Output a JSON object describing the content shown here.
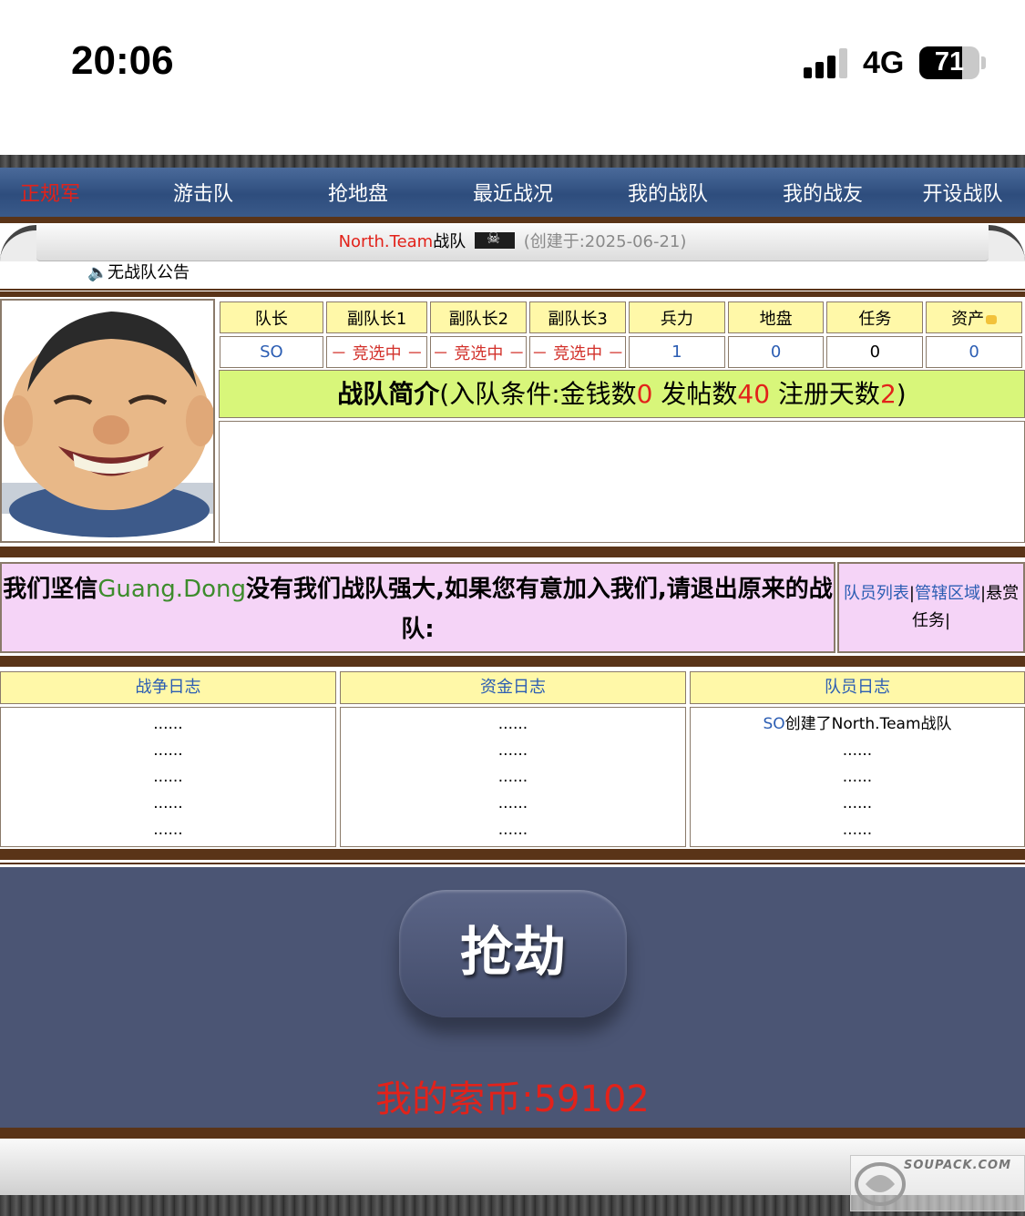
{
  "status_bar": {
    "time": "20:06",
    "network": "4G",
    "battery": "71",
    "battery_level": 0.71
  },
  "nav": {
    "items": [
      "正规军",
      "游击队",
      "抢地盘",
      "最近战况",
      "我的战队",
      "我的战友",
      "开设战队"
    ],
    "active_color": "#e2221a"
  },
  "banner": {
    "team_name": "North.Team",
    "team_suffix": "战队",
    "created": "(创建于:2025-06-21)",
    "notice": "无战队公告"
  },
  "team_table": {
    "headers": [
      "队长",
      "副队长1",
      "副队长2",
      "副队长3",
      "兵力",
      "地盘",
      "任务",
      "资产"
    ],
    "values": [
      "SO",
      "－ 竞选中 －",
      "－ 竞选中 －",
      "－ 竞选中 －",
      "1",
      "0",
      "0",
      "0"
    ]
  },
  "intro": {
    "title": "战队简介",
    "cond_prefix": "(入队条件:金钱数",
    "money": "0",
    "posts_label": " 发帖数",
    "posts": "40",
    "days_label": " 注册天数",
    "days": "2",
    "close": ")"
  },
  "recruit": {
    "before": "我们坚信",
    "highlight": "Guang.Dong",
    "after": "没有我们战队强大,如果您有意加入我们,请退出原来的战队:",
    "links": [
      "队员列表",
      "管辖区域",
      "悬赏任务"
    ]
  },
  "logs": {
    "war": {
      "title": "战争日志",
      "rows": [
        "......",
        "......",
        "......",
        "......",
        "......"
      ]
    },
    "funds": {
      "title": "资金日志",
      "rows": [
        "......",
        "......",
        "......",
        "......",
        "......"
      ]
    },
    "members": {
      "title": "队员日志",
      "first_user": "SO",
      "first_text": "创建了North.Team战队",
      "rows": [
        "......",
        "......",
        "......",
        "......"
      ]
    }
  },
  "rob": {
    "button": "抢劫",
    "coins": "我的索币:59102"
  },
  "watermark": {
    "text": "SOUPACK.COM"
  }
}
